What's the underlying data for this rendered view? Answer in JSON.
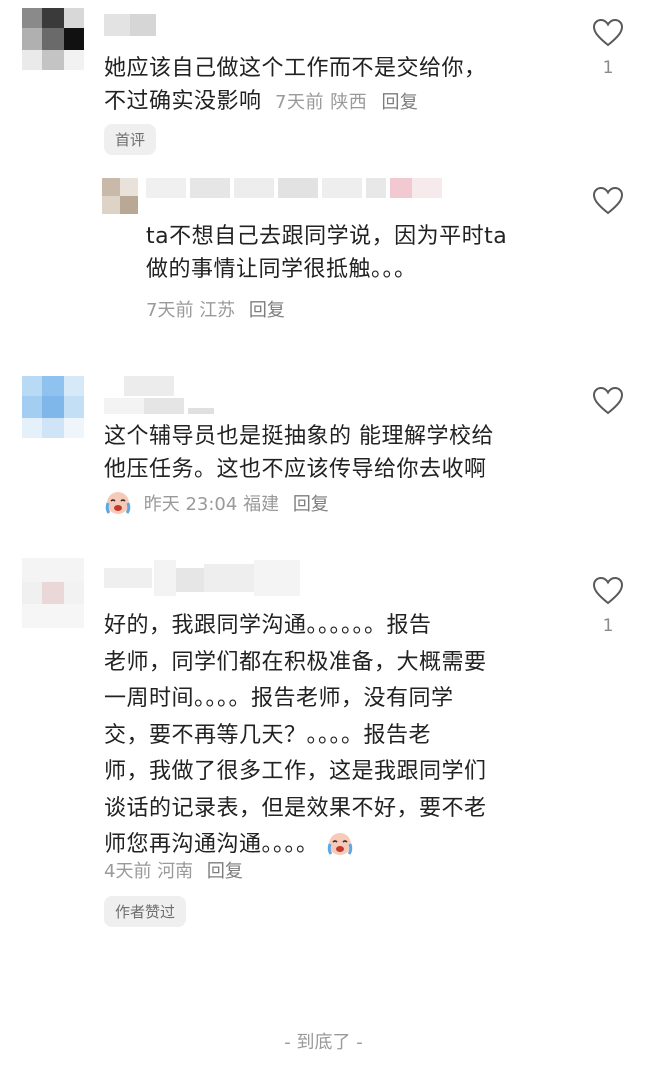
{
  "comments": [
    {
      "text_lines": [
        "她应该自己做这个工作而不是交给你，",
        "不过确实没影响"
      ],
      "time": "7天前",
      "region": "陕西",
      "reply_label": "回复",
      "tag": "首评",
      "likes": "1",
      "reply": {
        "text_lines": [
          "ta不想自己去跟同学说，因为平时ta",
          "做的事情让同学很抵触。。。"
        ],
        "time": "7天前",
        "region": "江苏",
        "reply_label": "回复"
      }
    },
    {
      "text_lines": [
        "这个辅导员也是挺抽象的 能理解学校给",
        "他压任务。这也不应该传导给你去收啊"
      ],
      "time": "昨天 23:04",
      "region": "福建",
      "reply_label": "回复",
      "emoji": "crying-face-emoji"
    },
    {
      "text_lines": [
        "好的，我跟同学沟通。。。。。。报告",
        "老师，同学们都在积极准备，大概需要",
        "一周时间。。。。报告老师，没有同学",
        "交，要不再等几天？。。。。报告老",
        "师，我做了很多工作，这是我跟同学们",
        "谈话的记录表，但是效果不好，要不老",
        "师您再沟通沟通。。。。"
      ],
      "time": "4天前",
      "region": "河南",
      "reply_label": "回复",
      "tag": "作者赞过",
      "likes": "1"
    }
  ],
  "footer": {
    "end_label": "- 到底了 -"
  },
  "icons": {
    "like": "heart-outline-icon",
    "emoji": "crying-face-emoji"
  },
  "colors": {
    "text": "#222222",
    "meta": "#9a9a9a",
    "tag_bg": "#efefef"
  }
}
